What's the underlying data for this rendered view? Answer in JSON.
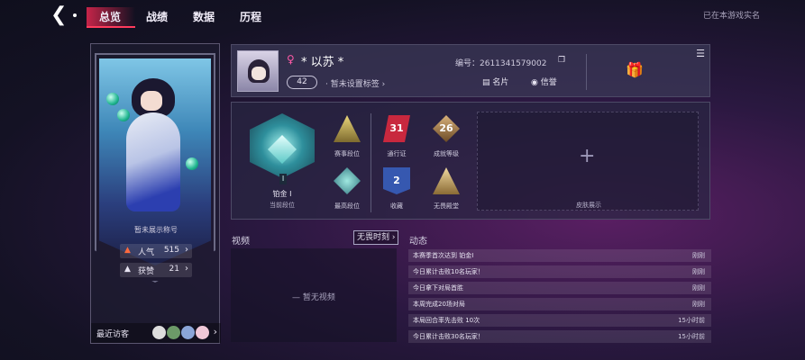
{
  "nav": {
    "tabs": [
      {
        "label": "总览",
        "active": true
      },
      {
        "label": "战绩",
        "active": false
      },
      {
        "label": "数据",
        "active": false
      },
      {
        "label": "历程",
        "active": false
      }
    ],
    "realname_text": "已在本游戏实名",
    "accent_color": "#ff3b5c"
  },
  "left_card": {
    "title_slot": "暂未展示称号",
    "popularity": {
      "label": "人气",
      "value": "515"
    },
    "likes": {
      "label": "获赞",
      "value": "21"
    },
    "visitors_label": "最近访客"
  },
  "profile": {
    "gender_icon": "female-icon",
    "nickname": "* 以苏 *",
    "level": "42",
    "tag_text": "暂未设置标签",
    "id_text": "编号：2611341579002",
    "card_label": "名片",
    "credit_label": "信誉"
  },
  "rank": {
    "current_tier": "铂金 I",
    "current_label": "当前段位",
    "badges": [
      {
        "label": "赛事段位",
        "value": ""
      },
      {
        "label": "通行证",
        "value": "31"
      },
      {
        "label": "成就等级",
        "value": "26"
      },
      {
        "label": "最高段位",
        "value": ""
      },
      {
        "label": "收藏",
        "value": "2"
      },
      {
        "label": "无畏殿堂",
        "value": ""
      }
    ],
    "skin_label": "皮肤展示"
  },
  "video": {
    "title": "视频",
    "filter": "无畏时刻",
    "empty_text": "暂无视频"
  },
  "activity": {
    "title": "动态",
    "items": [
      {
        "text": "本赛季首次达到 铂金I",
        "time": "刚刚"
      },
      {
        "text": "今日累计击败10名玩家！",
        "time": "刚刚"
      },
      {
        "text": "今日拿下对局首胜",
        "time": "刚刚"
      },
      {
        "text": "本周完成20场对局",
        "time": "刚刚"
      },
      {
        "text": "本局回合率先击败 10次",
        "time": "15小时前"
      },
      {
        "text": "今日累计击败30名玩家！",
        "time": "15小时前"
      }
    ]
  }
}
